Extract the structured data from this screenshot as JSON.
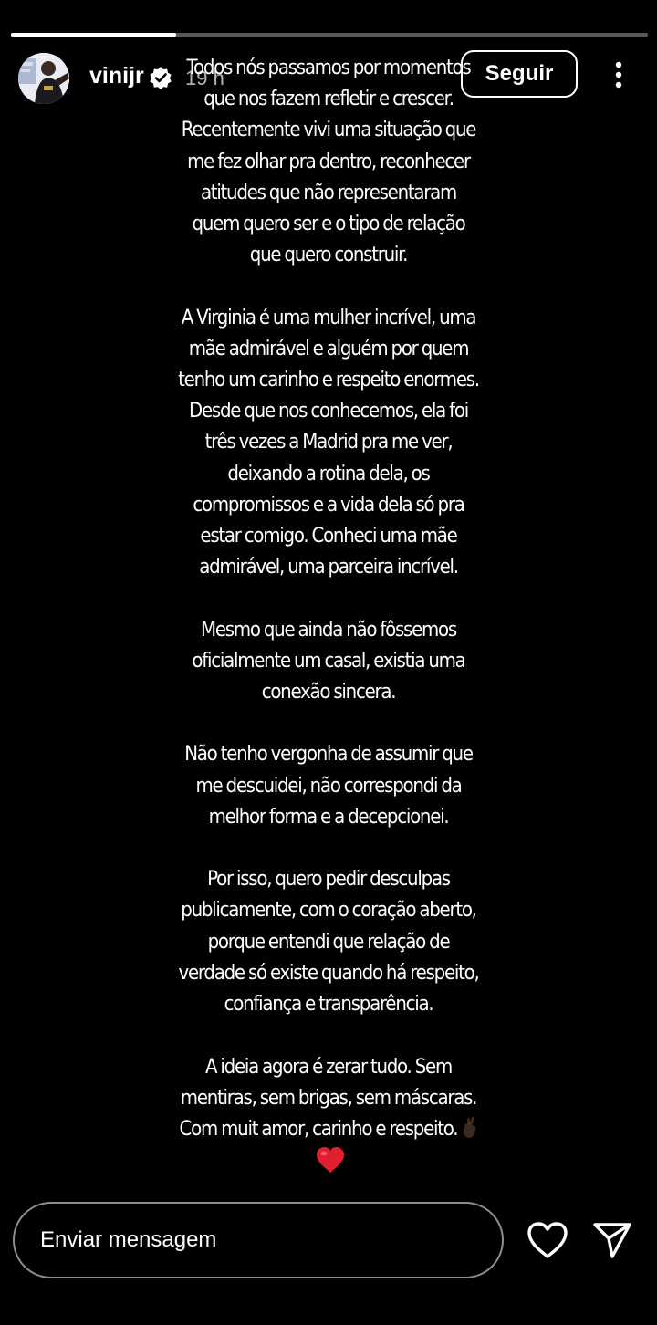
{
  "story": {
    "progress_fraction": 0.26,
    "username": "vinijr",
    "verified": true,
    "time_ago": "19 h",
    "follow_label": "Seguir",
    "caption": "Todos nós passamos por momentos\nque nos fazem refletir e crescer.\nRecentemente vivi uma situação que\nme fez olhar pra dentro, reconhecer\natitudes que não representaram\nquem quero ser e o tipo de relação\nque quero construir.\n\nA Virginia é uma mulher incrível, uma\nmãe admirável e alguém por quem\ntenho um carinho e respeito enormes.\nDesde que nos conhecemos, ela foi\ntrês vezes a Madrid pra me ver,\ndeixando a rotina dela, os\ncompromissos e a vida dela só pra\nestar comigo. Conheci uma mãe\nadmirável, uma parceira incrível.\n\nMesmo que ainda não fôssemos\noficialmente um casal, existia uma\nconexão sincera.\n\nNão tenho vergonha de assumir que\nme descuidei, não correspondi  da\nmelhor forma e a decepcionei.\n\nPor isso, quero pedir desculpas\npublicamente, com o coração aberto,\nporque entendi que relação de\nverdade só existe quando há respeito,\nconfiança e transparência.\n\nA ideia agora é zerar tudo. Sem\nmentiras, sem brigas, sem máscaras.\nCom muit amor, carinho e respeito. ",
    "caption_emojis": [
      "crossed-fingers-emoji",
      "red-heart-emoji"
    ]
  },
  "reply_bar": {
    "placeholder": "Enviar mensagem"
  },
  "icons": {
    "more": "more-vertical-icon",
    "like": "heart-outline-icon",
    "share": "paper-plane-icon",
    "verified": "verified-badge-icon"
  },
  "colors": {
    "background": "#000000",
    "text": "#ffffff",
    "heart_emoji": "#e0202e",
    "verified_badge": "#ffffff"
  }
}
